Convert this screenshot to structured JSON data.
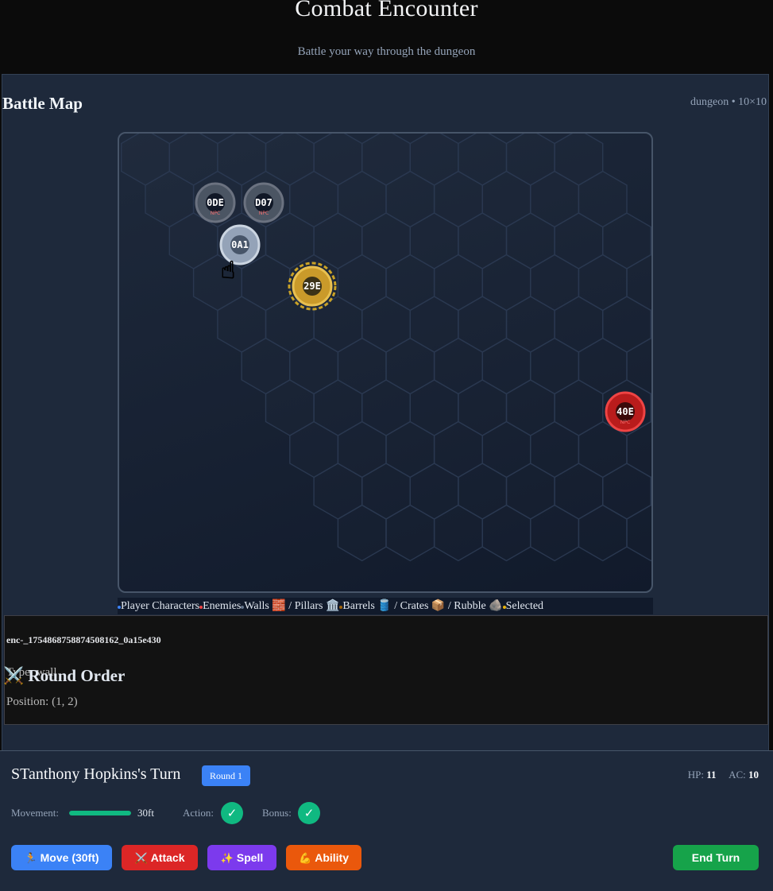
{
  "header": {
    "title": "Combat Encounter",
    "subtitle": "Battle your way through the dungeon"
  },
  "map": {
    "title": "Battle Map",
    "meta": "dungeon • 10×10",
    "tokens": [
      {
        "label": "0DE",
        "sub": "NPC",
        "kind": "npc"
      },
      {
        "label": "D07",
        "sub": "NPC",
        "kind": "npc"
      },
      {
        "label": "0A1",
        "sub": "",
        "kind": "hover"
      },
      {
        "label": "29E",
        "sub": "",
        "kind": "selected"
      },
      {
        "label": "40E",
        "sub": "NPC",
        "kind": "enemy"
      }
    ],
    "legend": [
      {
        "color": "#3b82f6",
        "text": "Player Characters"
      },
      {
        "color": "#ef4444",
        "text": "Enemies"
      },
      {
        "color": "#64748b",
        "text": "Walls 🧱 / Pillars 🏛️"
      },
      {
        "color": "#a16207",
        "text": "Barrels 🛢️ / Crates 📦 / Rubble 🪨"
      },
      {
        "color": "#eab308",
        "text": "Selected"
      }
    ]
  },
  "info": {
    "id": "enc-_1754868758874508162_0a15e430",
    "type": "Type: wall",
    "position": "Position: (1, 2)"
  },
  "initiative": {
    "peek": "⚔️ Round Order"
  },
  "turn": {
    "title": "STanthony Hopkins's Turn",
    "round": "Round 1",
    "hp_label": "HP:",
    "hp": "11",
    "ac_label": "AC:",
    "ac": "10",
    "movement_label": "Movement:",
    "movement_value": "30ft",
    "movement_fraction": 1.0,
    "action_label": "Action:",
    "bonus_label": "Bonus:",
    "check": "✓",
    "buttons": {
      "move": {
        "icon": "🏃",
        "label": "Move (30ft)",
        "color": "#3b82f6"
      },
      "attack": {
        "icon": "⚔️",
        "label": "Attack",
        "color": "#dc2626"
      },
      "spell": {
        "icon": "✨",
        "label": "Spell",
        "color": "#7c3aed"
      },
      "ability": {
        "icon": "💪",
        "label": "Ability",
        "color": "#ea580c"
      },
      "end": {
        "label": "End Turn",
        "color": "#16a34a"
      }
    }
  }
}
